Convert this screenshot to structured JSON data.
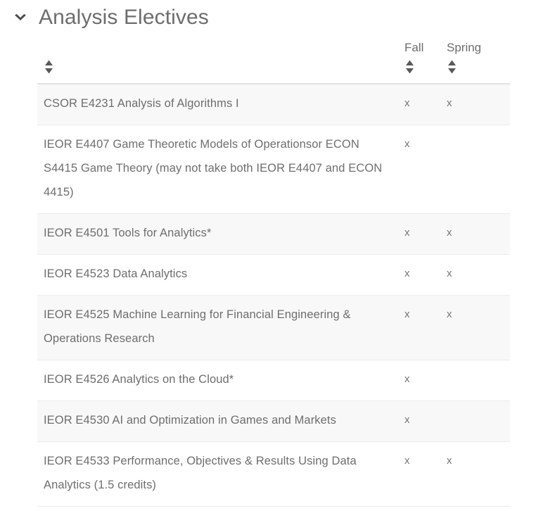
{
  "section": {
    "toggle_icon": "chevron-down-icon",
    "title": "Analysis Electives",
    "expanded": true
  },
  "table": {
    "columns": [
      {
        "key": "name",
        "label": "",
        "sort_icon": "sort-updown-icon"
      },
      {
        "key": "fall",
        "label": "Fall",
        "sort_icon": "sort-updown-icon"
      },
      {
        "key": "spring",
        "label": "Spring",
        "sort_icon": "sort-updown-icon"
      }
    ],
    "mark": "x",
    "rows": [
      {
        "name": "CSOR E4231 Analysis of Algorithms I",
        "fall": "x",
        "spring": "x"
      },
      {
        "name": "IEOR E4407 Game Theoretic Models of Operationsor ECON S4415 Game Theory (may not take both IEOR E4407 and ECON 4415)",
        "fall": "x",
        "spring": ""
      },
      {
        "name": "IEOR E4501 Tools for Analytics*",
        "fall": "x",
        "spring": "x"
      },
      {
        "name": "IEOR E4523 Data Analytics",
        "fall": "x",
        "spring": "x"
      },
      {
        "name": "IEOR E4525 Machine Learning for Financial Engineering & Operations Research",
        "fall": "x",
        "spring": "x"
      },
      {
        "name": "IEOR E4526 Analytics on the Cloud*",
        "fall": "x",
        "spring": ""
      },
      {
        "name": "IEOR E4530 AI and Optimization in Games and Markets",
        "fall": "x",
        "spring": ""
      },
      {
        "name": "IEOR E4533 Performance, Objectives & Results Using Data Analytics (1.5 credits)",
        "fall": "x",
        "spring": "x"
      }
    ]
  },
  "colors": {
    "title_text": "#6d6d6d",
    "body_text": "#6e6e6e",
    "stripe_bg": "#f8f8f8",
    "row_border": "#ececec",
    "header_border": "#e2e2e2",
    "icon": "#555555"
  }
}
